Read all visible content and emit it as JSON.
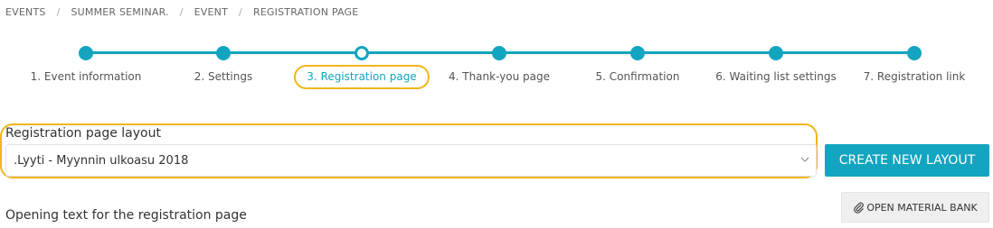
{
  "breadcrumb": [
    "EVENTS",
    "SUMMER SEMINAR.",
    "EVENT",
    "REGISTRATION PAGE"
  ],
  "steps": [
    {
      "label": "1. Event information"
    },
    {
      "label": "2. Settings"
    },
    {
      "label": "3. Registration page",
      "active": true
    },
    {
      "label": "4. Thank-you page"
    },
    {
      "label": "5. Confirmation"
    },
    {
      "label": "6. Waiting list settings"
    },
    {
      "label": "7. Registration link"
    }
  ],
  "layout": {
    "title": "Registration page layout",
    "selected": ".Lyyti - Myynnin ulkoasu 2018",
    "create_button": "CREATE NEW LAYOUT"
  },
  "material_bank_button": "OPEN MATERIAL BANK",
  "opening_text_label": "Opening text for the registration page",
  "colors": {
    "accent": "#13a5c0",
    "highlight": "#f2b61b"
  },
  "icons": {
    "chevron": "chevron-down-icon",
    "paperclip": "paperclip-icon"
  }
}
